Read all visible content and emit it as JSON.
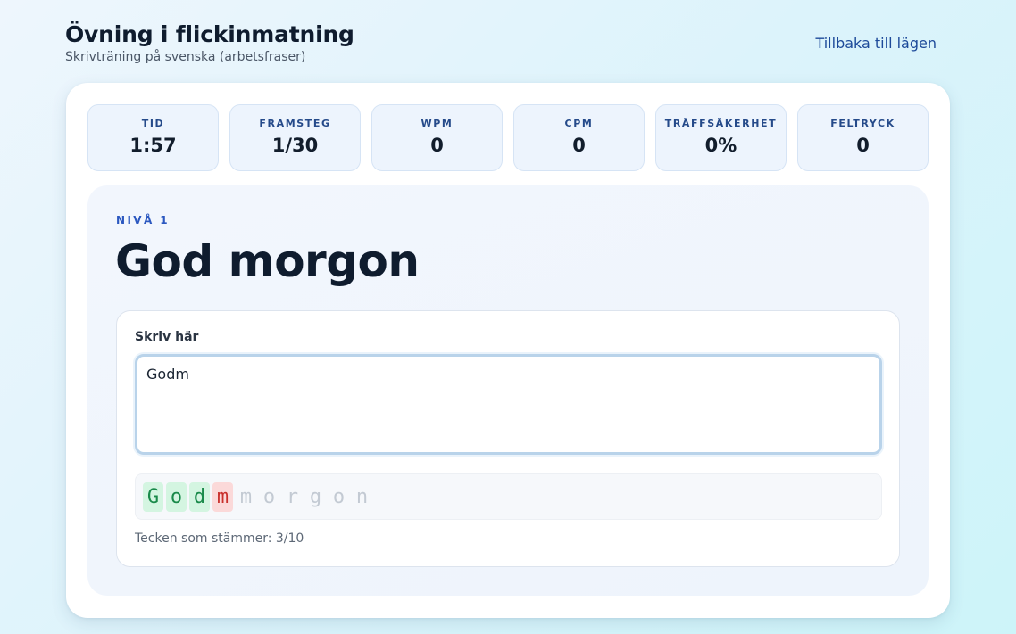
{
  "header": {
    "title": "Övning i flickinmatning",
    "subtitle": "Skrivträning på svenska (arbetsfraser)",
    "back_label": "Tillbaka till lägen"
  },
  "stats": [
    {
      "label": "TID",
      "value": "1:57"
    },
    {
      "label": "FRAMSTEG",
      "value": "1/30"
    },
    {
      "label": "WPM",
      "value": "0"
    },
    {
      "label": "CPM",
      "value": "0"
    },
    {
      "label": "TRÄFFSÄKERHET",
      "value": "0%"
    },
    {
      "label": "FELTRYCK",
      "value": "0"
    }
  ],
  "practice": {
    "level_label": "NIVÅ 1",
    "phrase": "God morgon",
    "input_label": "Skriv här",
    "input_value": "Godm",
    "chars": [
      {
        "char": "G",
        "state": "ok"
      },
      {
        "char": "o",
        "state": "ok"
      },
      {
        "char": "d",
        "state": "ok"
      },
      {
        "char": "m",
        "state": "bad"
      },
      {
        "char": "m",
        "state": "pending"
      },
      {
        "char": "o",
        "state": "pending"
      },
      {
        "char": "r",
        "state": "pending"
      },
      {
        "char": "g",
        "state": "pending"
      },
      {
        "char": "o",
        "state": "pending"
      },
      {
        "char": "n",
        "state": "pending"
      }
    ],
    "match_text": "Tecken som stämmer: 3/10"
  },
  "colors": {
    "accent": "#2c58c0",
    "correct_bg": "#d4f5e1",
    "correct_fg": "#1a8a4a",
    "error_bg": "#fbd9d9",
    "error_fg": "#c9302c",
    "pending_fg": "#c3cad3"
  }
}
